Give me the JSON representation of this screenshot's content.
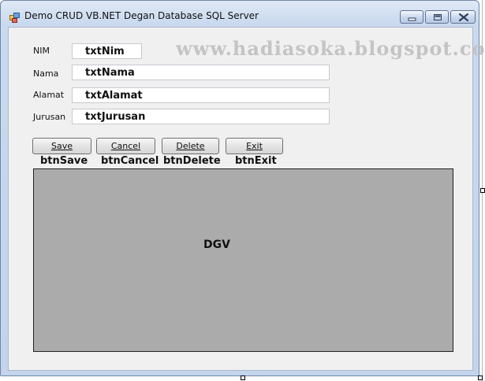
{
  "window": {
    "title": "Demo CRUD VB.NET Degan Database SQL Server"
  },
  "watermark": "www.hadiasoka.blogspot.com",
  "form": {
    "fields": [
      {
        "label": "NIM",
        "value": "txtNim"
      },
      {
        "label": "Nama",
        "value": "txtNama"
      },
      {
        "label": "Alamat",
        "value": "txtAlamat"
      },
      {
        "label": "Jurusan",
        "value": "txtJurusan"
      }
    ]
  },
  "buttons": [
    {
      "label": "Save",
      "caption": "btnSave"
    },
    {
      "label": "Cancel",
      "caption": "btnCancel"
    },
    {
      "label": "Delete",
      "caption": "btnDelete"
    },
    {
      "label": "Exit",
      "caption": "btnExit"
    }
  ],
  "grid": {
    "label": "DGV"
  },
  "icons": {
    "app": "app-window-icon",
    "minimize": "minimize-icon",
    "maximize": "maximize-icon",
    "close": "close-icon"
  },
  "colors": {
    "grid_background": "#ababab",
    "form_background": "#f0f0f0",
    "watermark": "#c4c4c4"
  }
}
